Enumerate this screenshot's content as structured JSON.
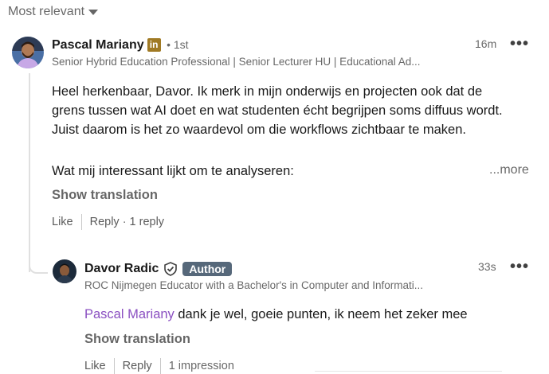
{
  "sort": {
    "label": "Most relevant"
  },
  "comment": {
    "author": "Pascal Mariany",
    "badge": "in",
    "degree": "• 1st",
    "headline": "Senior Hybrid Education Professional | Senior Lecturer HU | Educational Ad...",
    "time": "16m",
    "menu": "•••",
    "lines": [
      "Heel herkenbaar, Davor. Ik merk in mijn onderwijs en projecten ook dat de",
      "grens tussen wat AI doet en wat studenten écht begrijpen soms diffuus wordt.",
      "Juist daarom is het zo waardevol om die workflows zichtbaar te maken."
    ],
    "line4": "Wat mij interessant lijkt om te analyseren:",
    "more": "...more",
    "translate": "Show translation",
    "like": "Like",
    "reply": "Reply",
    "reply_dot": "·",
    "reply_count": "1 reply"
  },
  "reply": {
    "author": "Davor Radic",
    "author_badge": "Author",
    "headline": "ROC Nijmegen Educator with a Bachelor's in Computer and Informati...",
    "time": "33s",
    "menu": "•••",
    "mention": "Pascal Mariany",
    "text": " dank je wel, goeie punten, ik neem het zeker mee",
    "translate": "Show translation",
    "like": "Like",
    "reply": "Reply",
    "impressions": "1 impression"
  },
  "colors": {
    "linkedin_badge": "#a07a24",
    "author_badge": "#56687a",
    "mention": "#8a4fc1"
  },
  "icons": [
    "chevron-down-icon",
    "linkedin-icon",
    "verified-shield-icon",
    "more-icon"
  ]
}
